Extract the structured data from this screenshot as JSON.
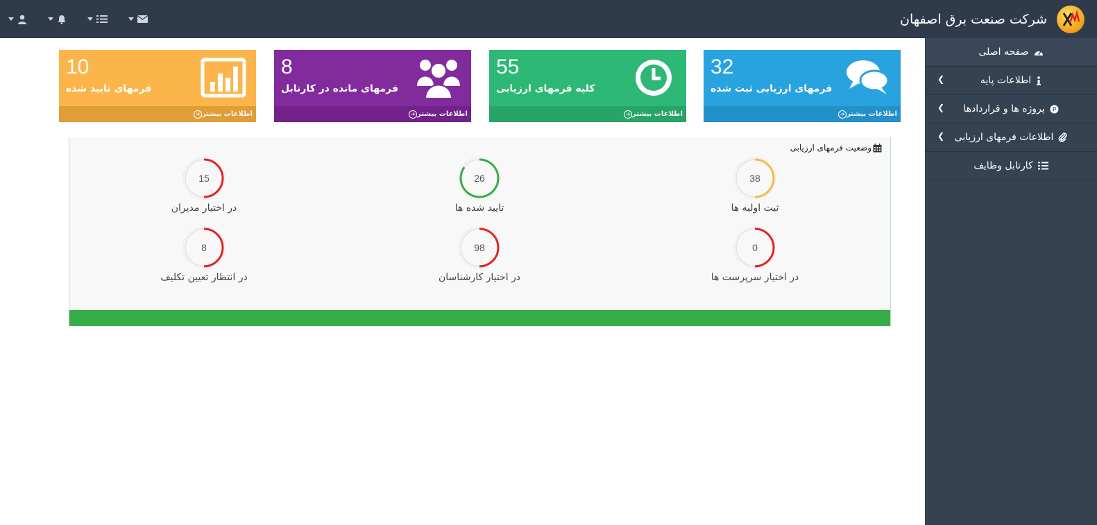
{
  "brand": {
    "title": "شرکت صنعت برق اصفهان",
    "logo_icon": "company-logo-icon"
  },
  "navbar": {
    "icons": [
      {
        "name": "user-icon",
        "glyph": "user"
      },
      {
        "name": "bell-icon",
        "glyph": "bell"
      },
      {
        "name": "tasks-icon",
        "glyph": "tasks"
      },
      {
        "name": "envelope-icon",
        "glyph": "envelope"
      }
    ]
  },
  "sidebar": {
    "items": [
      {
        "label": "صفحه اصلی",
        "icon": "dashboard-icon",
        "has_submenu": false
      },
      {
        "label": "اطلاعات پایه",
        "icon": "info-icon",
        "has_submenu": true
      },
      {
        "label": "پروژه ها و قراردادها",
        "icon": "project-icon",
        "has_submenu": true
      },
      {
        "label": "اطلاعات فرمهای ارزیابی",
        "icon": "paperclip-icon",
        "has_submenu": true
      },
      {
        "label": "کارتابل وظایف",
        "icon": "tasks-icon",
        "has_submenu": false
      }
    ]
  },
  "stats": {
    "registered": {
      "value": "32",
      "label": "فرمهای ارزیابی ثبت شده",
      "more": "اطلاعات بیشتر",
      "color": "#29a3e0",
      "icon": "comments-icon"
    },
    "all_forms": {
      "value": "55",
      "label": "کلیه فرمهای ارزیابی",
      "more": "اطلاعات بیشتر",
      "color": "#2db875",
      "icon": "clock-icon"
    },
    "in_cartable": {
      "value": "8",
      "label": "فرمهای مانده در کارتابل",
      "more": "اطلاعات بیشتر",
      "color": "#822b9c",
      "icon": "users-icon"
    },
    "approved": {
      "value": "10",
      "label": "فرمهای تایید شده",
      "more": "اطلاعات بیشتر",
      "color": "#fbb54a",
      "icon": "bar-chart-icon"
    }
  },
  "status_panel": {
    "title": "وضعیت فرمهای ارزیابی",
    "icon": "calendar-icon",
    "gauges": [
      {
        "value": "38",
        "label": "ثبت اولیه ها",
        "color": "#f7b84b",
        "fraction": 0.5
      },
      {
        "value": "26",
        "label": "تایید شده ها",
        "color": "#3aa84a",
        "fraction": 0.85
      },
      {
        "value": "15",
        "label": "در اختیار مدیران",
        "color": "#e02424",
        "fraction": 0.5
      },
      {
        "value": "0",
        "label": "در اختیار سرپرست ها",
        "color": "#e02424",
        "fraction": 0.5
      },
      {
        "value": "98",
        "label": "در اختیار کارشناسان",
        "color": "#e02424",
        "fraction": 0.5
      },
      {
        "value": "8",
        "label": "در انتظار تعیین تکلیف",
        "color": "#e02424",
        "fraction": 0.5
      }
    ]
  }
}
